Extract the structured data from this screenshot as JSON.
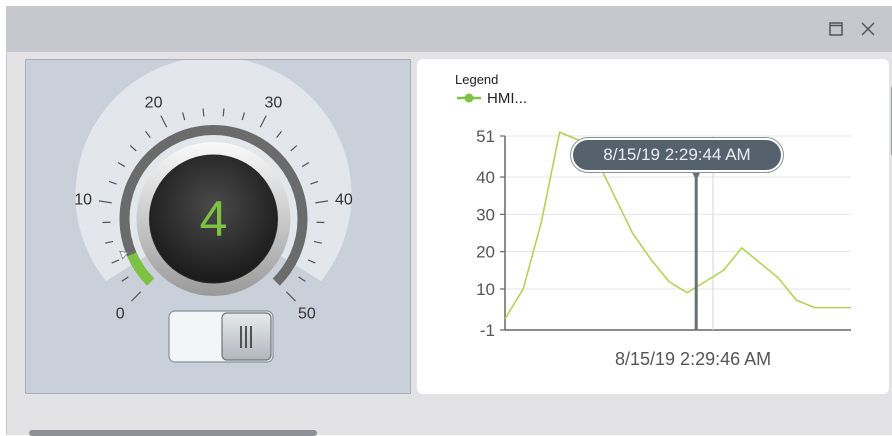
{
  "window": {
    "restore_icon": "restore-icon",
    "close_icon": "close-icon"
  },
  "knob": {
    "value": "4",
    "min": 0,
    "max": 50,
    "tick_labels": [
      "0",
      "10",
      "20",
      "30",
      "40",
      "50"
    ],
    "accent_color": "#7dc242",
    "toggle_state": "on",
    "toggle_icon": "grip-icon"
  },
  "trend": {
    "legend_title": "Legend",
    "legend_item": "HMI...",
    "cursor_tooltip": "8/15/19 2:29:44 AM",
    "x_caption": "8/15/19 2:29:46 AM",
    "line_color": "#b4d25a"
  },
  "chart_data": {
    "type": "line",
    "title": "",
    "xlabel": "",
    "ylabel": "",
    "ylim": [
      -1,
      51
    ],
    "y_tick_labels": [
      "51",
      "40",
      "30",
      "20",
      "10",
      "-1"
    ],
    "y_ticks": [
      51,
      40,
      30,
      20,
      10,
      -1
    ],
    "grid": true,
    "legend_position": "top-left",
    "cursor_index": 10.5,
    "series": [
      {
        "name": "HMI...",
        "values": [
          2,
          10,
          28,
          52,
          50,
          45,
          35,
          25,
          18,
          12,
          9,
          12,
          15,
          21,
          17,
          13,
          7,
          5,
          5,
          5
        ]
      }
    ]
  }
}
